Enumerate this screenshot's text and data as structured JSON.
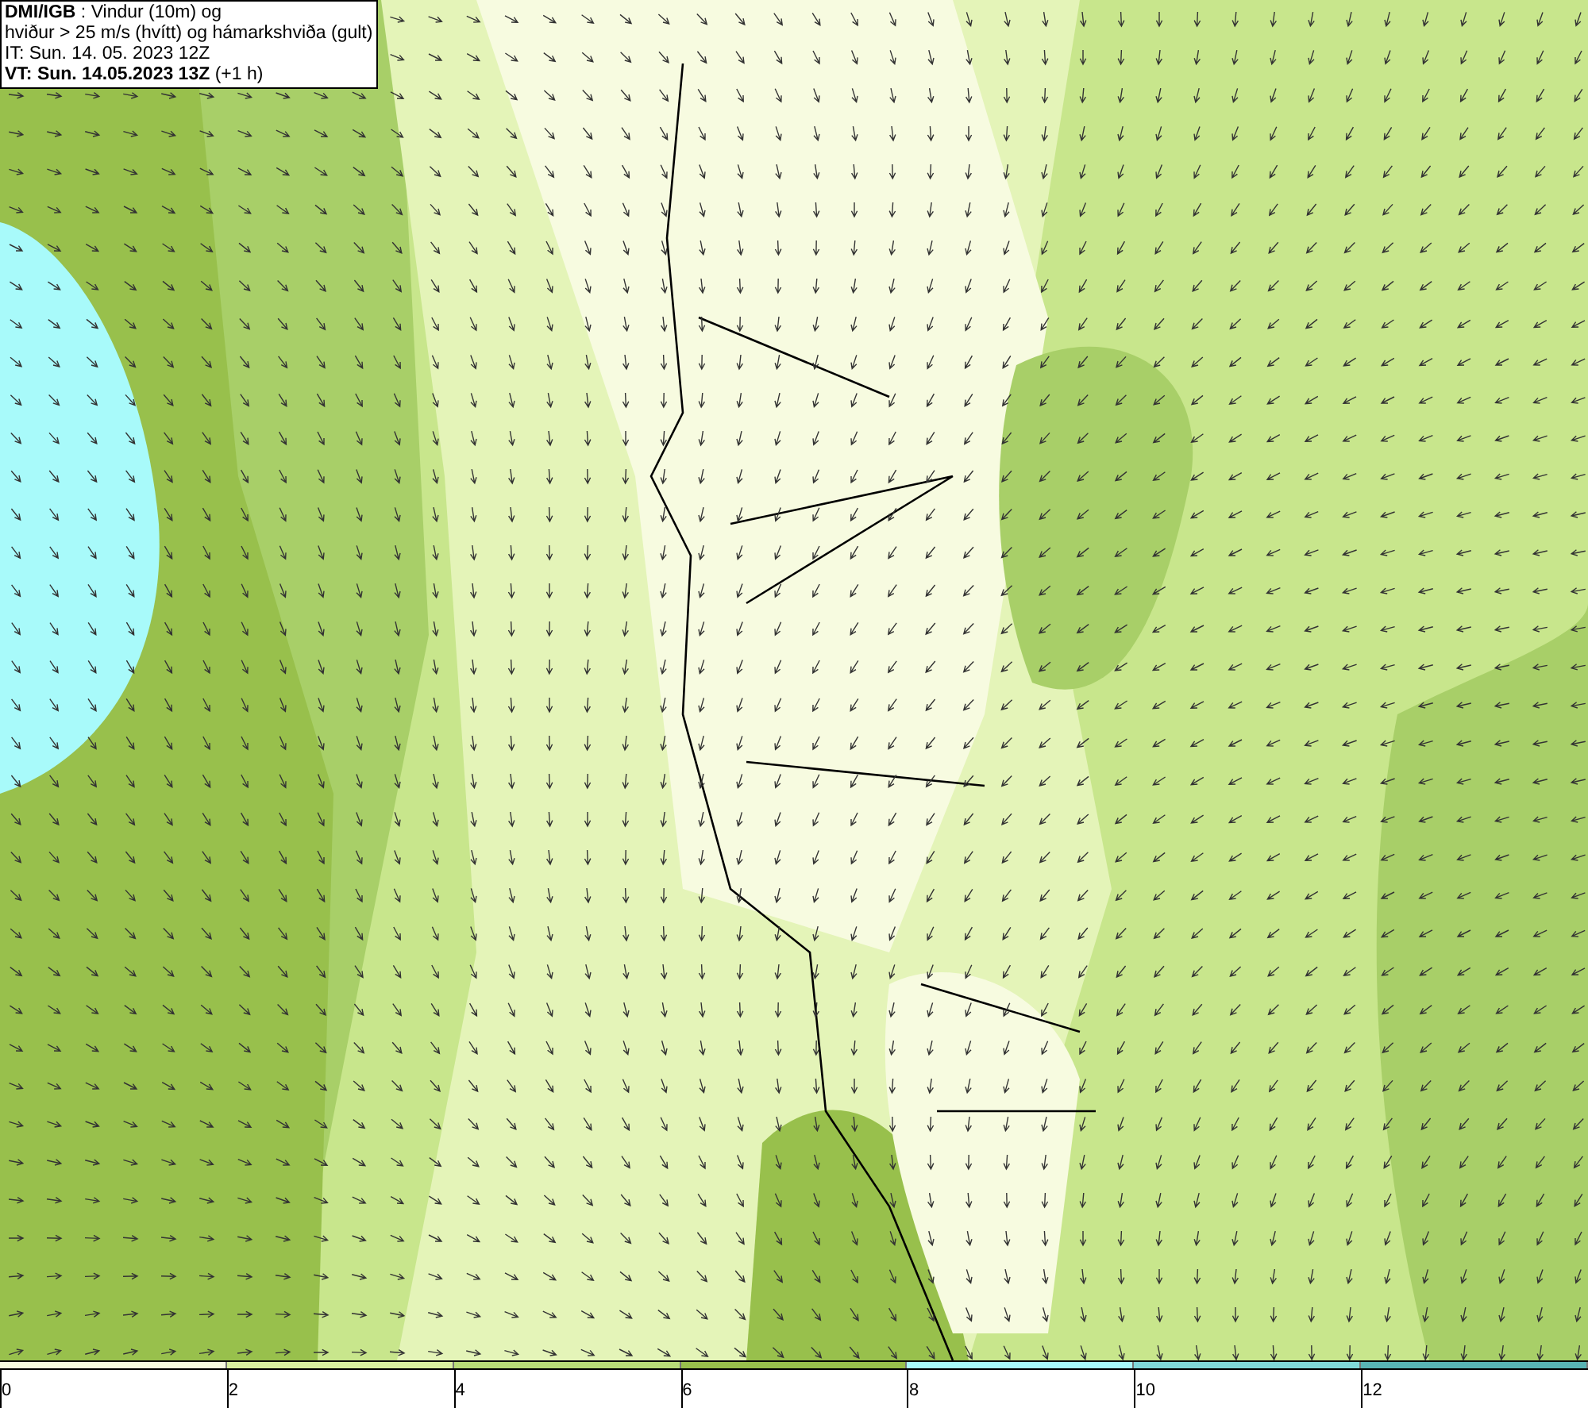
{
  "header": {
    "lines": [
      "**DMI/IGB** : Vindur (10m) og",
      "hviður > 25 m/s (hvítt) og hámarkshviða (gult)",
      "IT: Sun. 14. 05. 2023 12Z",
      "**VT: Sun. 14.05.2023 13Z** (+1 h)"
    ]
  },
  "legend": {
    "bins": [
      {
        "label": "0",
        "color": "#f7fbe0"
      },
      {
        "label": "2",
        "color": "#d9f0a0"
      },
      {
        "label": "4",
        "color": "#b8dc78"
      },
      {
        "label": "6",
        "color": "#98c04c"
      },
      {
        "label": "8",
        "color": "#a8fafa"
      },
      {
        "label": "10",
        "color": "#80d8d8"
      },
      {
        "label": "12",
        "color": "#58b4b4"
      }
    ]
  }
}
